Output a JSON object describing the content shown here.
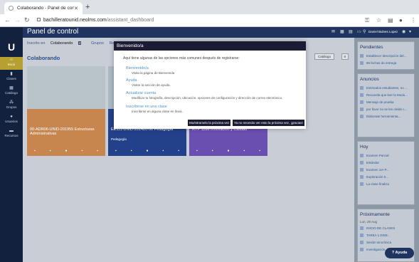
{
  "browser": {
    "tab_title": "Colaborando - Panel de control",
    "url_host": "bachilleratounid.neolms.com",
    "url_path": "/assistant_dashboard"
  },
  "app": {
    "title": "Panel de control",
    "user_name": "Daniel Bulnes Lopez",
    "sidebar": [
      {
        "label": "Inicio",
        "icon": "home-icon"
      },
      {
        "label": "Clases",
        "icon": "book-icon"
      },
      {
        "label": "Catálogo",
        "icon": "grid-icon"
      },
      {
        "label": "Grupos",
        "icon": "group-icon"
      },
      {
        "label": "Usuarios",
        "icon": "user-icon"
      },
      {
        "label": "Recursos",
        "icon": "folder-icon"
      }
    ],
    "subtabs": {
      "t1": "Inscrito en",
      "t2": "Colaborando",
      "t2_badge": "4",
      "t3": "Grupos",
      "t4": "Recientes"
    },
    "section_title": "Colaborando",
    "catalog_label": "Catálogo",
    "cards": [
      {
        "title": "00-ADR06-UNID-201955 Estructuras Administrativas",
        "subtitle": "",
        "color": "#c8864f"
      },
      {
        "title": "EE111-UNID-201420-00 Pedagogía",
        "subtitle": "Pedagogía",
        "color": "#23418a"
      },
      {
        "title": "RYP 1186 Innovación y Calidad",
        "subtitle": "",
        "color": "#6a4fb0"
      }
    ],
    "right": {
      "pendientes": {
        "title": "Pendientes",
        "items": [
          "Establecer descripción del...",
          "85 fechas de entrega"
        ]
      },
      "anuncios": {
        "title": "Anuncios",
        "items": [
          "Estimados estudiantes, no ...",
          "Recuerda que leer la Modu...",
          "Mensaje de prueba",
          "por favor no se les olvide c...",
          "Elaborate herramienta..."
        ]
      },
      "hoy": {
        "title": "Hoy",
        "items": [
          "Examen Parcial",
          "Estándar",
          "Examen 1er P...",
          "Exploración II...",
          "La clase finaliza"
        ]
      },
      "proximamente": {
        "title": "Próximamente",
        "date": "Lun, 29 Aug",
        "items": [
          "INICIO DE CLASES",
          "TAREA 1 DISE...",
          "Sesión sincrónica",
          "Investigación..."
        ]
      }
    },
    "help_label": "Ayuda"
  },
  "modal": {
    "title": "Bienvenido/a",
    "intro": "Aquí tiene algunas de las opciones más comunes después de registrarse:",
    "options": [
      {
        "link": "Bienvenido/a",
        "desc": "Visita la página de Bienvenida"
      },
      {
        "link": "Ayuda",
        "desc": "Visitar la sección de ayuda."
      },
      {
        "link": "Actualizar cuenta",
        "desc": "Modificar tu fotografía, descripción, ubicación, opciones de configuración y dirección de correo electrónico."
      },
      {
        "link": "Inscribirse en una clase",
        "desc": "Inscribirse en alguna clase en línea."
      }
    ],
    "btn_later": "Muéstramelo la próxima vez",
    "btn_never": "Ya no necesito ver esto la próxima vez, ¡gracias!"
  }
}
